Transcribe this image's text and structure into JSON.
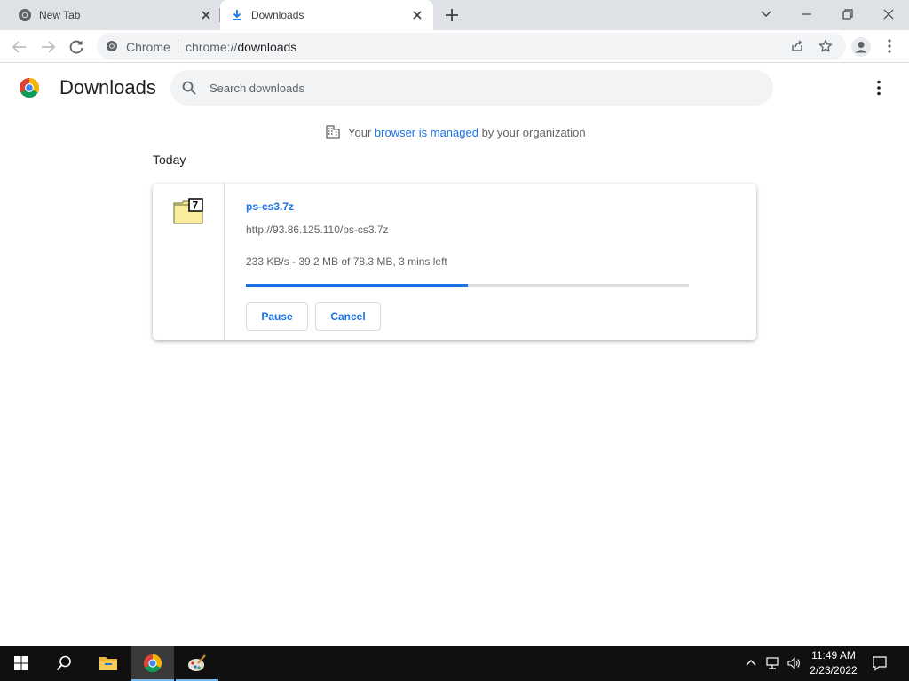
{
  "tabs": [
    {
      "title": "New Tab",
      "icon": "chrome-icon",
      "active": false
    },
    {
      "title": "Downloads",
      "icon": "download-icon",
      "active": true
    }
  ],
  "toolbar": {
    "omnibox_chip": "Chrome",
    "url_scheme": "chrome://",
    "url_host": "downloads"
  },
  "downloads_page": {
    "title": "Downloads",
    "search_placeholder": "Search downloads",
    "managed_prefix": "Your ",
    "managed_link": "browser is managed",
    "managed_suffix": " by your organization",
    "section_date": "Today"
  },
  "download": {
    "file_name": "ps-cs3.7z",
    "url": "http://93.86.125.110/ps-cs3.7z",
    "status": "233 KB/s - 39.2 MB of 78.3 MB, 3 mins left",
    "progress_fraction": 0.5,
    "pause_label": "Pause",
    "cancel_label": "Cancel",
    "file_icon": "7z-archive-icon"
  },
  "taskbar": {
    "items": [
      "windows-start-icon",
      "search-icon",
      "file-explorer-icon",
      "chrome-icon",
      "paint-icon"
    ],
    "time": "11:49 AM",
    "date": "2/23/2022"
  },
  "colors": {
    "accent": "#1a73e8",
    "tabstrip": "#dee1e6",
    "taskbar": "#101010"
  }
}
